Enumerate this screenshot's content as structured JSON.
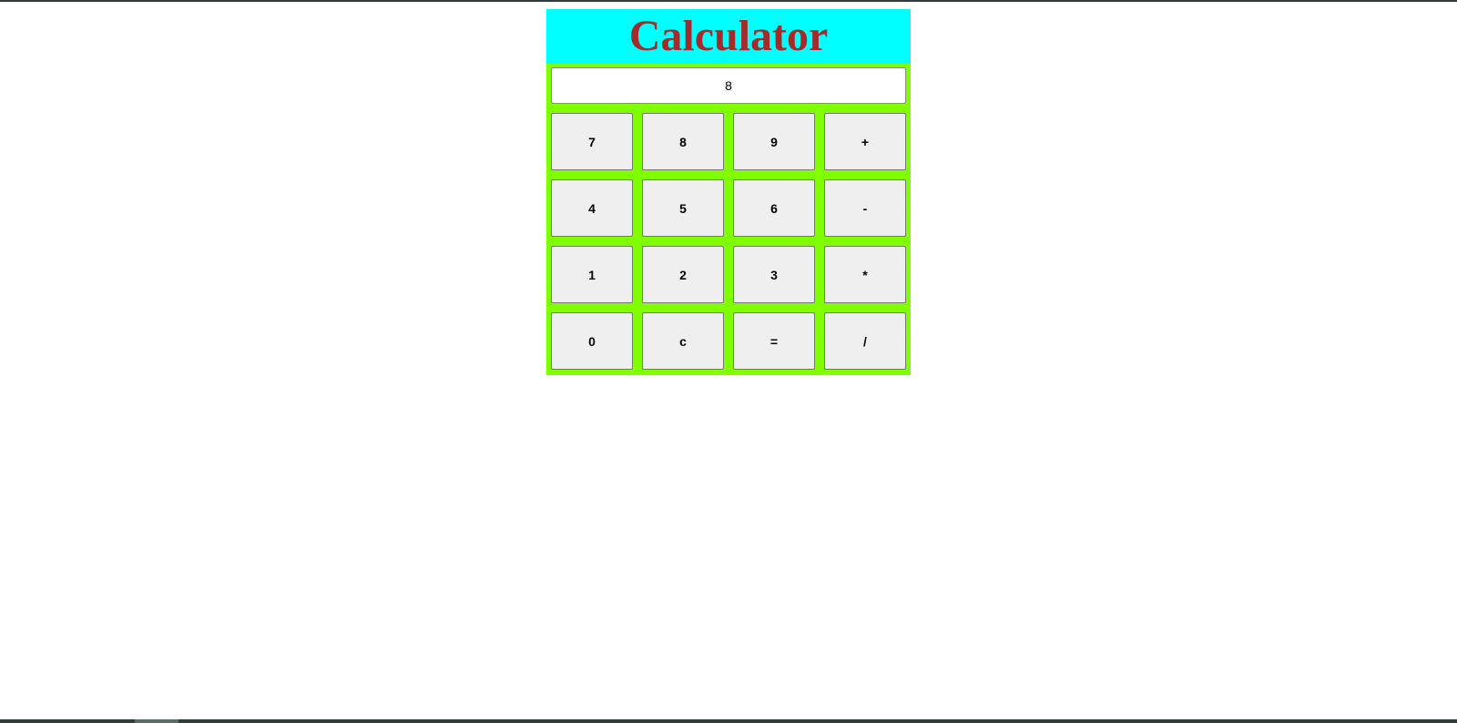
{
  "colors": {
    "header_background": "#00ffff",
    "title_color": "#a52a2a",
    "body_background": "#7fff00"
  },
  "calculator": {
    "title": "Calculator",
    "display_value": "8",
    "keys": [
      {
        "label": "7",
        "name": "key-7"
      },
      {
        "label": "8",
        "name": "key-8"
      },
      {
        "label": "9",
        "name": "key-9"
      },
      {
        "label": "+",
        "name": "key-plus"
      },
      {
        "label": "4",
        "name": "key-4"
      },
      {
        "label": "5",
        "name": "key-5"
      },
      {
        "label": "6",
        "name": "key-6"
      },
      {
        "label": "-",
        "name": "key-minus"
      },
      {
        "label": "1",
        "name": "key-1"
      },
      {
        "label": "2",
        "name": "key-2"
      },
      {
        "label": "3",
        "name": "key-3"
      },
      {
        "label": "*",
        "name": "key-multiply"
      },
      {
        "label": "0",
        "name": "key-0"
      },
      {
        "label": "c",
        "name": "key-clear"
      },
      {
        "label": "=",
        "name": "key-equals"
      },
      {
        "label": "/",
        "name": "key-divide"
      }
    ]
  }
}
